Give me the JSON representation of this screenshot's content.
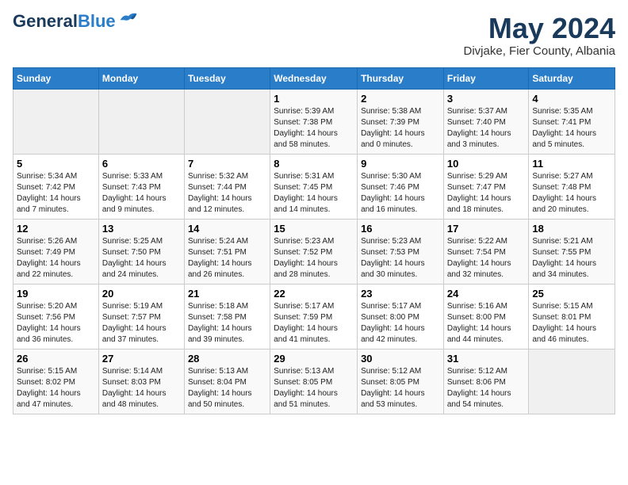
{
  "header": {
    "logo_general": "General",
    "logo_blue": "Blue",
    "month_year": "May 2024",
    "location": "Divjake, Fier County, Albania"
  },
  "days_of_week": [
    "Sunday",
    "Monday",
    "Tuesday",
    "Wednesday",
    "Thursday",
    "Friday",
    "Saturday"
  ],
  "weeks": [
    [
      {
        "day": "",
        "info": ""
      },
      {
        "day": "",
        "info": ""
      },
      {
        "day": "",
        "info": ""
      },
      {
        "day": "1",
        "info": "Sunrise: 5:39 AM\nSunset: 7:38 PM\nDaylight: 14 hours\nand 58 minutes."
      },
      {
        "day": "2",
        "info": "Sunrise: 5:38 AM\nSunset: 7:39 PM\nDaylight: 14 hours\nand 0 minutes."
      },
      {
        "day": "3",
        "info": "Sunrise: 5:37 AM\nSunset: 7:40 PM\nDaylight: 14 hours\nand 3 minutes."
      },
      {
        "day": "4",
        "info": "Sunrise: 5:35 AM\nSunset: 7:41 PM\nDaylight: 14 hours\nand 5 minutes."
      }
    ],
    [
      {
        "day": "5",
        "info": "Sunrise: 5:34 AM\nSunset: 7:42 PM\nDaylight: 14 hours\nand 7 minutes."
      },
      {
        "day": "6",
        "info": "Sunrise: 5:33 AM\nSunset: 7:43 PM\nDaylight: 14 hours\nand 9 minutes."
      },
      {
        "day": "7",
        "info": "Sunrise: 5:32 AM\nSunset: 7:44 PM\nDaylight: 14 hours\nand 12 minutes."
      },
      {
        "day": "8",
        "info": "Sunrise: 5:31 AM\nSunset: 7:45 PM\nDaylight: 14 hours\nand 14 minutes."
      },
      {
        "day": "9",
        "info": "Sunrise: 5:30 AM\nSunset: 7:46 PM\nDaylight: 14 hours\nand 16 minutes."
      },
      {
        "day": "10",
        "info": "Sunrise: 5:29 AM\nSunset: 7:47 PM\nDaylight: 14 hours\nand 18 minutes."
      },
      {
        "day": "11",
        "info": "Sunrise: 5:27 AM\nSunset: 7:48 PM\nDaylight: 14 hours\nand 20 minutes."
      }
    ],
    [
      {
        "day": "12",
        "info": "Sunrise: 5:26 AM\nSunset: 7:49 PM\nDaylight: 14 hours\nand 22 minutes."
      },
      {
        "day": "13",
        "info": "Sunrise: 5:25 AM\nSunset: 7:50 PM\nDaylight: 14 hours\nand 24 minutes."
      },
      {
        "day": "14",
        "info": "Sunrise: 5:24 AM\nSunset: 7:51 PM\nDaylight: 14 hours\nand 26 minutes."
      },
      {
        "day": "15",
        "info": "Sunrise: 5:23 AM\nSunset: 7:52 PM\nDaylight: 14 hours\nand 28 minutes."
      },
      {
        "day": "16",
        "info": "Sunrise: 5:23 AM\nSunset: 7:53 PM\nDaylight: 14 hours\nand 30 minutes."
      },
      {
        "day": "17",
        "info": "Sunrise: 5:22 AM\nSunset: 7:54 PM\nDaylight: 14 hours\nand 32 minutes."
      },
      {
        "day": "18",
        "info": "Sunrise: 5:21 AM\nSunset: 7:55 PM\nDaylight: 14 hours\nand 34 minutes."
      }
    ],
    [
      {
        "day": "19",
        "info": "Sunrise: 5:20 AM\nSunset: 7:56 PM\nDaylight: 14 hours\nand 36 minutes."
      },
      {
        "day": "20",
        "info": "Sunrise: 5:19 AM\nSunset: 7:57 PM\nDaylight: 14 hours\nand 37 minutes."
      },
      {
        "day": "21",
        "info": "Sunrise: 5:18 AM\nSunset: 7:58 PM\nDaylight: 14 hours\nand 39 minutes."
      },
      {
        "day": "22",
        "info": "Sunrise: 5:17 AM\nSunset: 7:59 PM\nDaylight: 14 hours\nand 41 minutes."
      },
      {
        "day": "23",
        "info": "Sunrise: 5:17 AM\nSunset: 8:00 PM\nDaylight: 14 hours\nand 42 minutes."
      },
      {
        "day": "24",
        "info": "Sunrise: 5:16 AM\nSunset: 8:00 PM\nDaylight: 14 hours\nand 44 minutes."
      },
      {
        "day": "25",
        "info": "Sunrise: 5:15 AM\nSunset: 8:01 PM\nDaylight: 14 hours\nand 46 minutes."
      }
    ],
    [
      {
        "day": "26",
        "info": "Sunrise: 5:15 AM\nSunset: 8:02 PM\nDaylight: 14 hours\nand 47 minutes."
      },
      {
        "day": "27",
        "info": "Sunrise: 5:14 AM\nSunset: 8:03 PM\nDaylight: 14 hours\nand 48 minutes."
      },
      {
        "day": "28",
        "info": "Sunrise: 5:13 AM\nSunset: 8:04 PM\nDaylight: 14 hours\nand 50 minutes."
      },
      {
        "day": "29",
        "info": "Sunrise: 5:13 AM\nSunset: 8:05 PM\nDaylight: 14 hours\nand 51 minutes."
      },
      {
        "day": "30",
        "info": "Sunrise: 5:12 AM\nSunset: 8:05 PM\nDaylight: 14 hours\nand 53 minutes."
      },
      {
        "day": "31",
        "info": "Sunrise: 5:12 AM\nSunset: 8:06 PM\nDaylight: 14 hours\nand 54 minutes."
      },
      {
        "day": "",
        "info": ""
      }
    ]
  ]
}
